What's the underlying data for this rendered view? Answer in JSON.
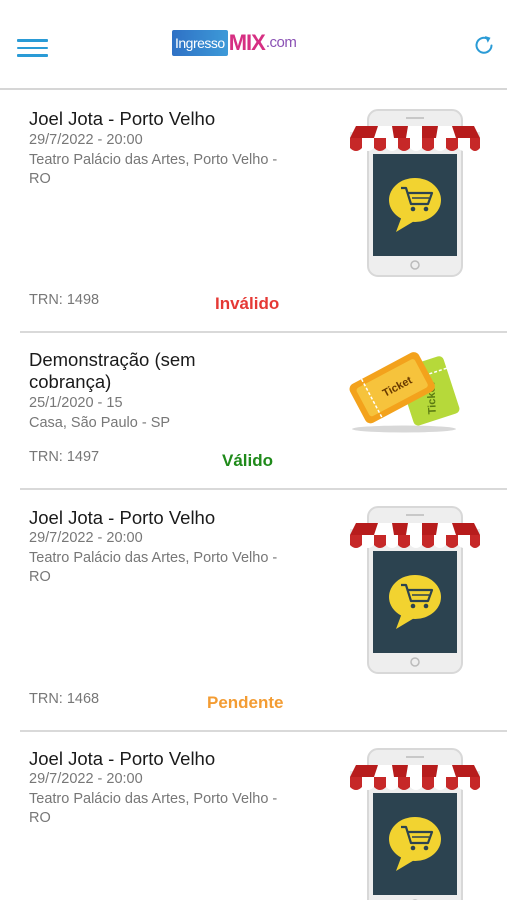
{
  "header": {
    "logo": {
      "part1": "Ingresso",
      "part2": "MIX",
      "part3": ".com"
    },
    "menu_icon": "hamburger-menu-icon",
    "refresh_icon": "refresh-icon"
  },
  "colors": {
    "accent": "#2a9bd6",
    "invalid": "#e53935",
    "valid": "#1f8a1a",
    "pending": "#f39c33"
  },
  "tickets": [
    {
      "title": "Joel Jota - Porto Velho",
      "date": "29/7/2022 - 20:00",
      "venue": "Teatro Palácio das Artes, Porto Velho - RO",
      "trn": "TRN: 1498",
      "status": "Inválido",
      "image": "shop-phone-icon"
    },
    {
      "title": "Demonstração (sem cobrança)",
      "date": "25/1/2020 - 15",
      "venue": "Casa, São Paulo - SP",
      "trn": "TRN: 1497",
      "status": "Válido",
      "image": "ticket-icon",
      "image_text": "Ticket"
    },
    {
      "title": "Joel Jota - Porto Velho",
      "date": "29/7/2022 - 20:00",
      "venue": "Teatro Palácio das Artes, Porto Velho - RO",
      "trn": "TRN: 1468",
      "status": "Pendente",
      "image": "shop-phone-icon"
    },
    {
      "title": "Joel Jota - Porto Velho",
      "date": "29/7/2022 - 20:00",
      "venue": "Teatro Palácio das Artes, Porto Velho - RO",
      "image": "shop-phone-icon"
    }
  ]
}
